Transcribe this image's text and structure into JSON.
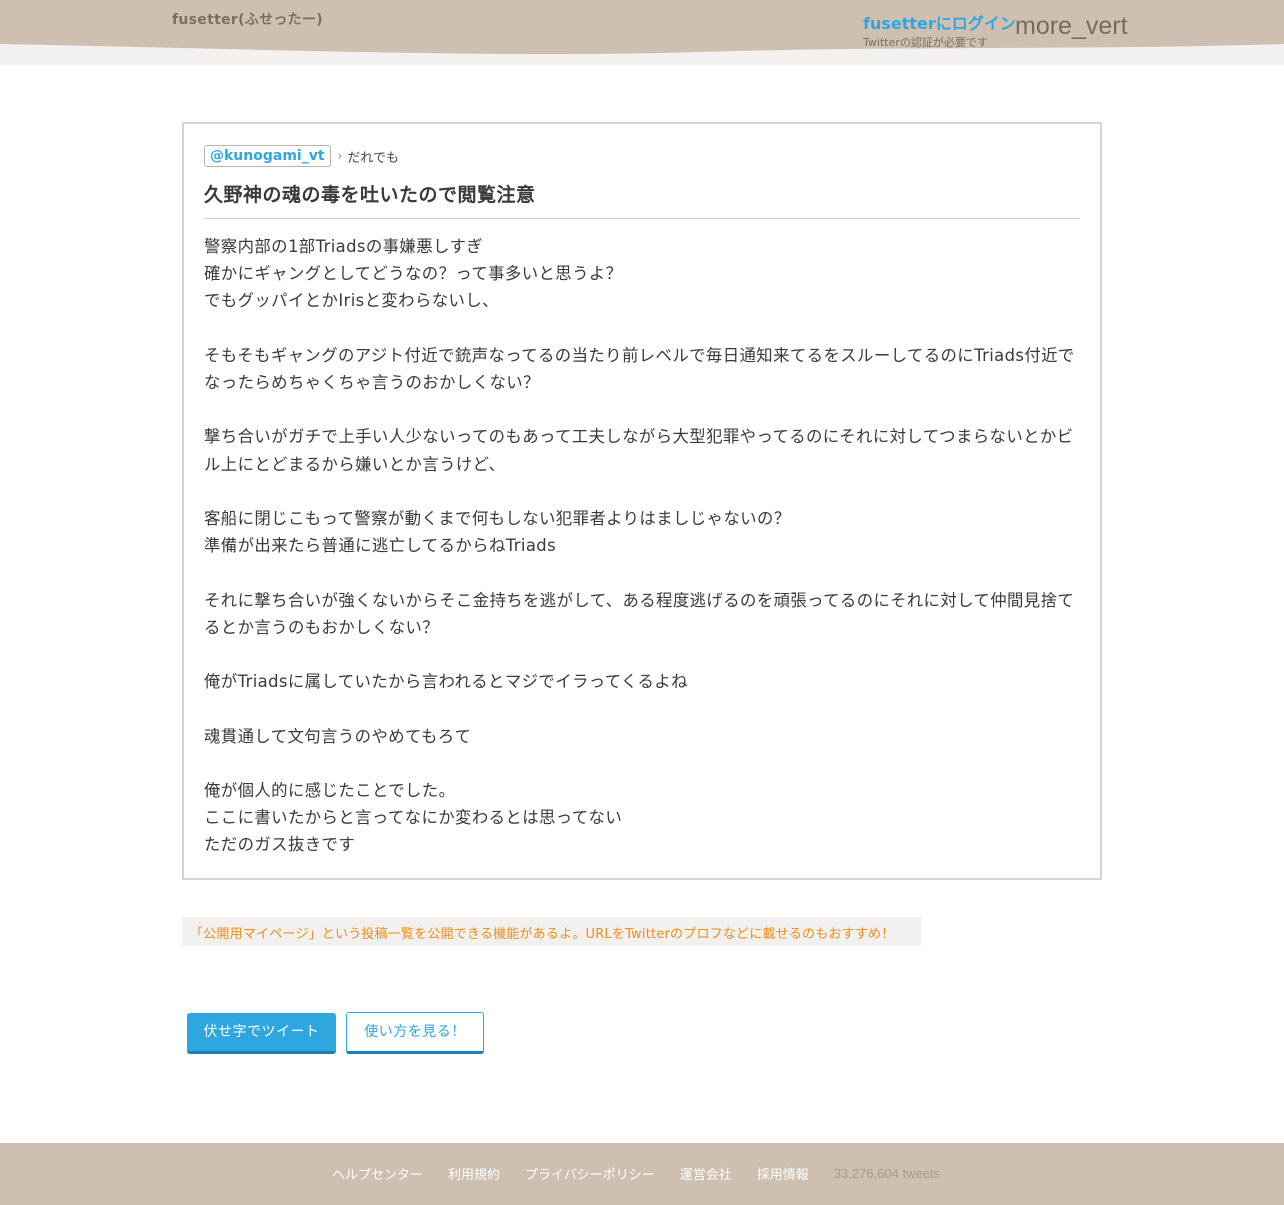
{
  "header": {
    "site_title": "fusetter(ふせったー)",
    "login_label": "fusetterにログイン",
    "login_note": "Twitterの認証が必要です",
    "menu_icon_text": "more_vert"
  },
  "post": {
    "author": "@kunogami_vt",
    "audience": "だれでも",
    "title": "久野神の魂の毒を吐いたので閲覧注意",
    "body_lines": [
      "警察内部の1部Triadsの事嫌悪しすぎ",
      "確かにギャングとしてどうなの？って事多いと思うよ？",
      "でもグッパイとかIrisと変わらないし、",
      "",
      "そもそもギャングのアジト付近で銃声なってるの当たり前レベルで毎日通知来てるをスルーしてるのにTriads付近で",
      "なったらめちゃくちゃ言うのおかしくない？",
      "",
      "撃ち合いがガチで上手い人少ないってのもあって工夫しながら大型犯罪やってるのにそれに対してつまらないとかビ",
      "ル上にとどまるから嫌いとか言うけど、",
      "",
      "客船に閉じこもって警察が動くまで何もしない犯罪者よりはましじゃないの？",
      "準備が出来たら普通に逃亡してるからねTriads",
      "",
      "それに撃ち合いが強くないからそこ金持ちを逃がして、ある程度逃げるのを頑張ってるのにそれに対して仲間見捨て",
      "るとか言うのもおかしくない？",
      "",
      "俺がTriadsに属していたから言われるとマジでイラってくるよね",
      "",
      "魂貫通して文句言うのやめてもろて",
      "",
      "俺が個人的に感じたことでした。",
      "ここに書いたからと言ってなにか変わるとは思ってない",
      "ただのガス抜きです"
    ]
  },
  "tip": "「公開用マイページ」という投稿一覧を公開できる機能があるよ。URLをTwitterのプロフなどに載せるのもおすすめ！",
  "buttons": {
    "tweet": "伏せ字でツイート",
    "howto": "使い方を見る！"
  },
  "footer": {
    "links": [
      "ヘルプセンター",
      "利用規約",
      "プライバシーポリシー",
      "運営会社",
      "採用情報"
    ],
    "tweet_count": "33,276,604 tweets"
  },
  "colors": {
    "accent": "#2ea7e0",
    "header_bg": "#cfbfb0",
    "tip_text": "#f28c16"
  }
}
